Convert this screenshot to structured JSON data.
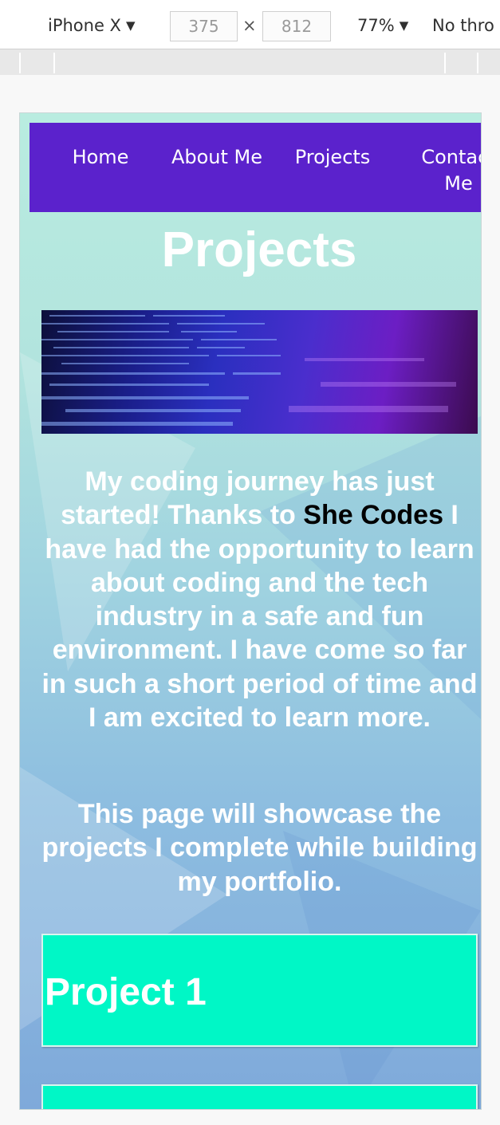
{
  "devtools": {
    "device": "iPhone X",
    "width": "375",
    "times": "×",
    "height": "812",
    "zoom": "77%",
    "throttling": "No thro"
  },
  "nav": {
    "items": [
      {
        "label": "Home"
      },
      {
        "label": "About Me"
      },
      {
        "label": "Projects"
      },
      {
        "label": "Contact Me"
      }
    ]
  },
  "page": {
    "title": "Projects",
    "intro_before": "My coding journey has just started! Thanks to ",
    "intro_brand": "She Codes",
    "intro_after": " I have had the opportunity to learn about coding and the tech industry in a safe and fun environment. I have come so far in such a short period of time and I am excited to learn more.",
    "intro2": "This page will showcase the projects I complete while building my portfolio."
  },
  "projects": [
    {
      "title": "Project 1"
    },
    {
      "title": ""
    }
  ],
  "colors": {
    "nav_bg": "#5b22cc",
    "card_bg": "#00f7c6",
    "brand_text": "#000000",
    "text": "#ffffff"
  }
}
